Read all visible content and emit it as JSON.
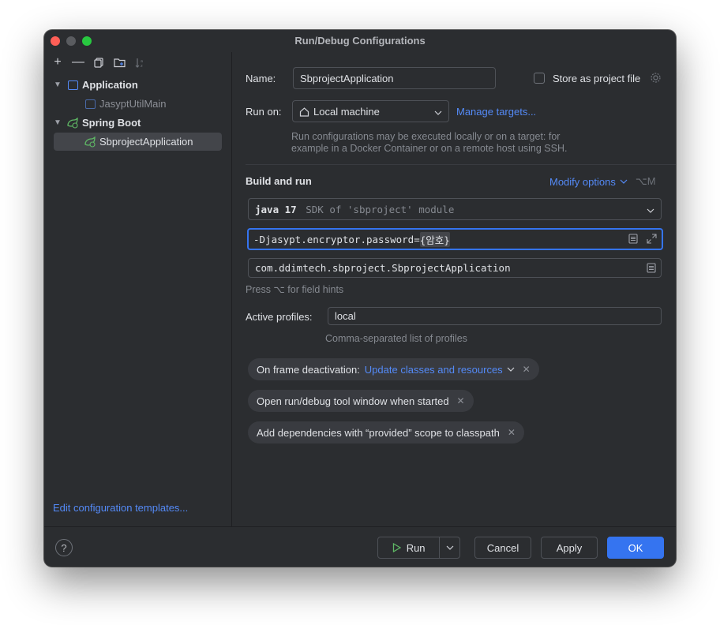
{
  "window": {
    "title": "Run/Debug Configurations"
  },
  "sidebar": {
    "toolbar": [
      {
        "name": "add-icon",
        "glyph": "+"
      },
      {
        "name": "remove-icon",
        "glyph": "—"
      },
      {
        "name": "copy-icon",
        "glyph": "⧉"
      },
      {
        "name": "new-folder-icon",
        "glyph": "⊞"
      },
      {
        "name": "sort-icon",
        "glyph": "⇅"
      }
    ],
    "tree": [
      {
        "label": "Application",
        "type": "group"
      },
      {
        "label": "JasyptUtilMain",
        "type": "child"
      },
      {
        "label": "Spring Boot",
        "type": "group"
      },
      {
        "label": "SbprojectApplication",
        "type": "child",
        "selected": true
      }
    ],
    "edit_templates": "Edit configuration templates..."
  },
  "form": {
    "name_label": "Name:",
    "name_value": "SbprojectApplication",
    "store_label": "Store as project file",
    "run_on_label": "Run on:",
    "run_on_value": "Local machine",
    "manage_targets": "Manage targets...",
    "run_on_hint": "Run configurations may be executed locally or on a target: for example in a Docker Container or on a remote host using SSH.",
    "build_run_title": "Build and run",
    "modify_options": "Modify options",
    "modify_shortcut": "⌥M",
    "sdk_bold": "java 17",
    "sdk_desc": "SDK of 'sbproject' module",
    "vm_options_prefix": "-Djasypt.encryptor.password=",
    "vm_options_placeholder": "{암호}",
    "main_class": "com.ddimtech.sbproject.SbprojectApplication",
    "field_hint": "Press ⌥ for field hints",
    "active_profiles_label": "Active profiles:",
    "active_profiles_value": "local",
    "active_profiles_hint": "Comma-separated list of profiles",
    "chips": {
      "frame_deactivation_label": "On frame deactivation:",
      "frame_deactivation_value": "Update classes and resources",
      "open_tool_window": "Open run/debug tool window when started",
      "add_dependencies": "Add dependencies with “provided” scope to classpath"
    }
  },
  "footer": {
    "help": "?",
    "run": "Run",
    "cancel": "Cancel",
    "apply": "Apply",
    "ok": "OK"
  }
}
